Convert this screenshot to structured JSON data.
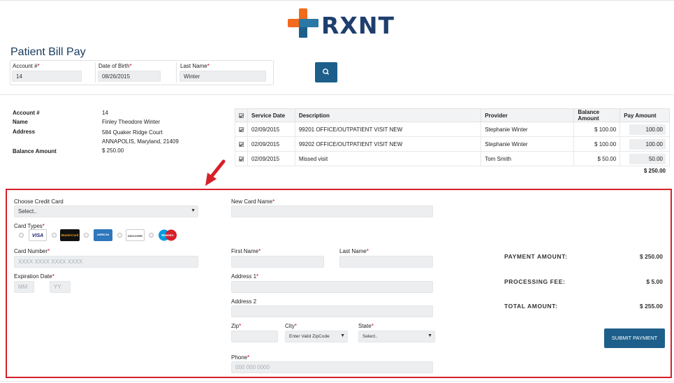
{
  "brand": {
    "name": "RXNT"
  },
  "page_title": "Patient Bill Pay",
  "search": {
    "account_label": "Account #",
    "account_value": "14",
    "dob_label": "Date of Birth",
    "dob_value": "08/26/2015",
    "last_name_label": "Last Name",
    "last_name_value": "Winter",
    "required_mark": "*"
  },
  "patient_info": {
    "account_label": "Account #",
    "account_value": "14",
    "name_label": "Name",
    "name_value": "Finley Theodore Winter",
    "address_label": "Address",
    "address_line1": "584 Quaker Ridge Court",
    "address_line2": "ANNAPOLIS, Maryland, 21409",
    "balance_label": "Balance Amount",
    "balance_value": "$ 250.00"
  },
  "bills_table": {
    "headers": [
      "Service Date",
      "Description",
      "Provider",
      "Balance Amount",
      "Pay Amount"
    ],
    "rows": [
      {
        "date": "02/09/2015",
        "description": "99201 OFFICE/OUTPATIENT VISIT NEW",
        "provider": "Stephanie Winter",
        "balance": "$ 100.00",
        "pay": "100.00"
      },
      {
        "date": "02/09/2015",
        "description": "99202 OFFICE/OUTPATIENT VISIT NEW",
        "provider": "Stephanie Winter",
        "balance": "$ 100.00",
        "pay": "100.00"
      },
      {
        "date": "02/09/2015",
        "description": "Missed visit",
        "provider": "Tom Smith",
        "balance": "$ 50.00",
        "pay": "50.00"
      }
    ],
    "total": "$ 250.00"
  },
  "payment_form": {
    "choose_card_label": "Choose Credit Card",
    "choose_card_value": "Select..",
    "card_types_label": "Card Types",
    "card_types": [
      "VISA",
      "MasterCard",
      "AMERICAN EXPRESS",
      "DISCOVER",
      "Maestro"
    ],
    "card_number_label": "Card Number",
    "card_number_placeholder": "XXXX XXXX XXXX XXXX",
    "expiration_label": "Expiration Date",
    "exp_month_placeholder": "MM",
    "exp_year_placeholder": "YY",
    "new_card_name_label": "New Card Name",
    "first_name_label": "First Name",
    "last_name_label": "Last Name",
    "address1_label": "Address 1",
    "address2_label": "Address 2",
    "zip_label": "Zip",
    "city_label": "City",
    "city_value": "Enter Valid ZipCode",
    "state_label": "State",
    "state_value": "Select..",
    "phone_label": "Phone",
    "phone_placeholder": "000 000 0000",
    "required_mark": "*"
  },
  "summary": {
    "payment_amount_label": "PAYMENT AMOUNT:",
    "payment_amount_value": "$ 250.00",
    "processing_fee_label": "PROCESSING FEE:",
    "processing_fee_value": "$ 5.00",
    "total_amount_label": "TOTAL AMOUNT:",
    "total_amount_value": "$ 255.00",
    "submit_label": "SUBMIT PAYMENT"
  },
  "colors": {
    "brand_navy": "#1e3f6e",
    "brand_orange": "#f26a1b",
    "button_blue": "#1d5f8a",
    "highlight_red": "#d6202a"
  }
}
